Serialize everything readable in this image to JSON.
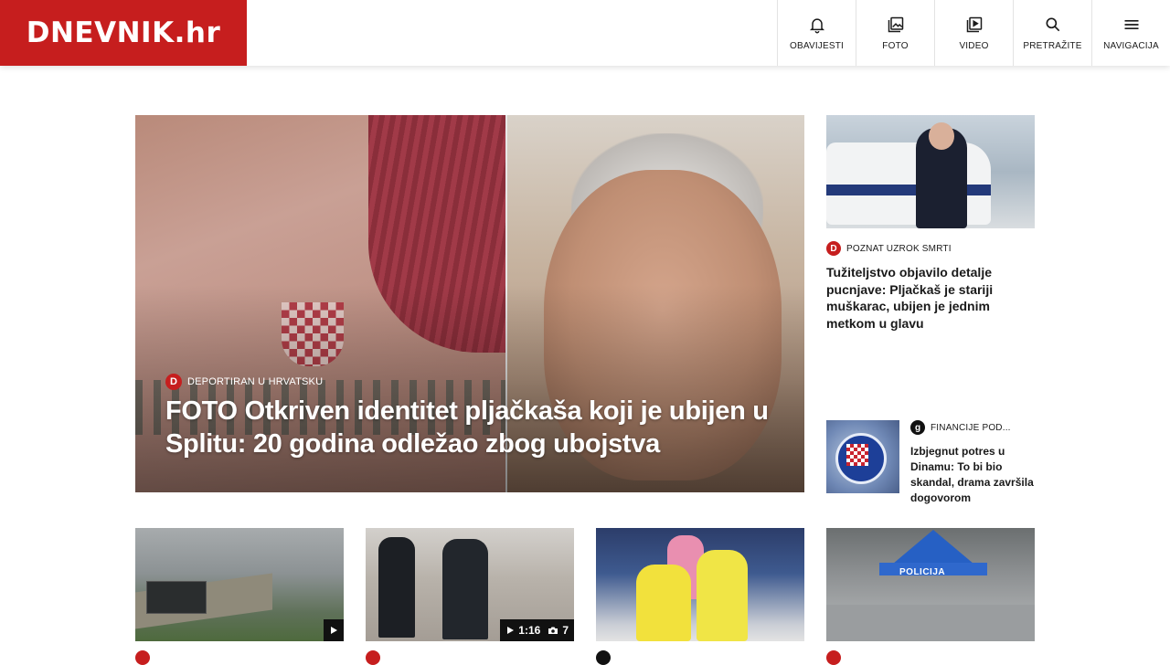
{
  "header": {
    "logo": "DNEVNIK.hr",
    "nav": [
      {
        "label": "OBAVIJESTI",
        "icon": "bell-icon"
      },
      {
        "label": "FOTO",
        "icon": "photo-gallery-icon"
      },
      {
        "label": "VIDEO",
        "icon": "video-play-icon"
      },
      {
        "label": "PRETRAŽITE",
        "icon": "search-icon"
      },
      {
        "label": "NAVIGACIJA",
        "icon": "hamburger-menu-icon"
      }
    ]
  },
  "hero": {
    "tag": "DEPORTIRAN U HRVATSKU",
    "title": "FOTO Otkriven identitet pljačkaša koji je ubijen u Splitu: 20 godina odležao zbog ubojstva"
  },
  "side": [
    {
      "badge": "D",
      "tag": "POZNAT UZROK SMRTI",
      "title": "Tužiteljstvo objavilo detalje pucnjave: Pljačkaš je stariji muškarac, ubijen je jednim metkom u glavu"
    },
    {
      "badge": "g",
      "tag": "FINANCIJE POD...",
      "title": "Izbjegnut potres u Dinamu: To bi bio skandal, drama završila dogovorom"
    }
  ],
  "cards": [
    {
      "media": "video"
    },
    {
      "media": "video-gallery",
      "duration": "1:16",
      "photos": "7"
    },
    {
      "media": "none"
    },
    {
      "media": "none",
      "tent_text": "POLICIJA"
    }
  ],
  "colors": {
    "brand": "#c61e1e"
  }
}
